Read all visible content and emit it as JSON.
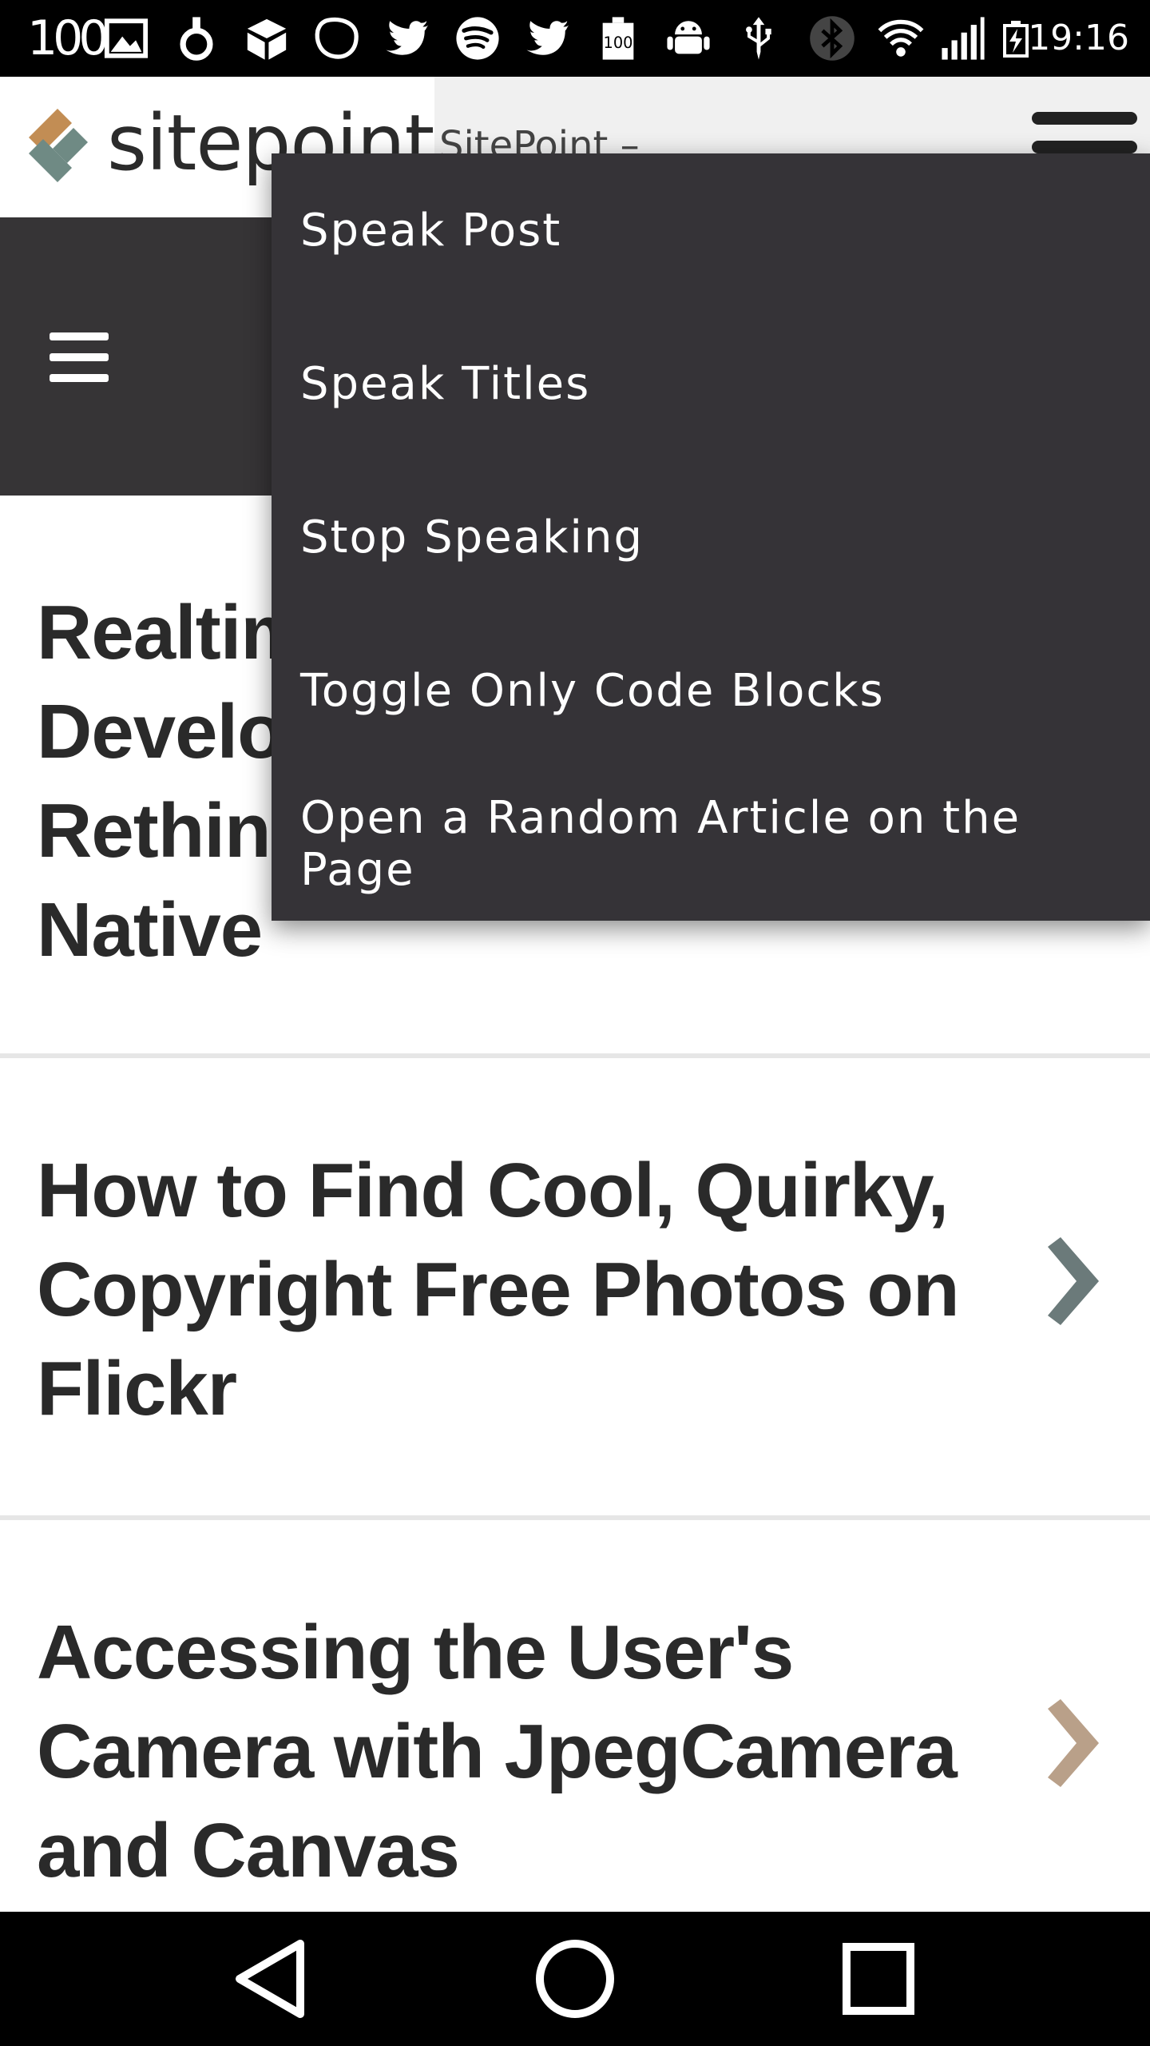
{
  "status_bar": {
    "battery_level": "100",
    "time": "19:16",
    "icons": [
      "image-icon",
      "ring-icon",
      "box-icon",
      "blob-icon",
      "twitter-icon",
      "spotify-icon",
      "twitter-icon",
      "battery-100-icon",
      "android-icon",
      "usb-icon",
      "bluetooth-icon",
      "wifi-icon",
      "signal-icon",
      "battery-charging-icon"
    ]
  },
  "header": {
    "logo_text": "sitepoint",
    "page_title": "SitePoint –"
  },
  "overflow_menu": {
    "items": [
      {
        "label": "Speak Post"
      },
      {
        "label": "Speak Titles"
      },
      {
        "label": "Stop Speaking"
      },
      {
        "label": "Toggle Only Code Blocks"
      },
      {
        "label": "Open a Random Article on the Page"
      }
    ]
  },
  "articles": [
    {
      "title_lines": [
        "Realtim",
        "Develo",
        "Rethin",
        "Native"
      ],
      "chevron_color": "#6b7a7a"
    },
    {
      "title_lines": [
        "How to Find Cool, Quirky,",
        "Copyright Free Photos on",
        "Flickr"
      ],
      "chevron_color": "#6b7a7a"
    },
    {
      "title_lines": [
        "Accessing the User's",
        "Camera with JpegCamera",
        "and Canvas"
      ],
      "chevron_color": "#b9a089"
    }
  ],
  "colors": {
    "dark_nav": "#363436",
    "menu_bg": "#353337",
    "text": "#2a2a2a"
  },
  "nav_bar": {
    "buttons": [
      "back-icon",
      "home-icon",
      "recents-icon"
    ]
  }
}
